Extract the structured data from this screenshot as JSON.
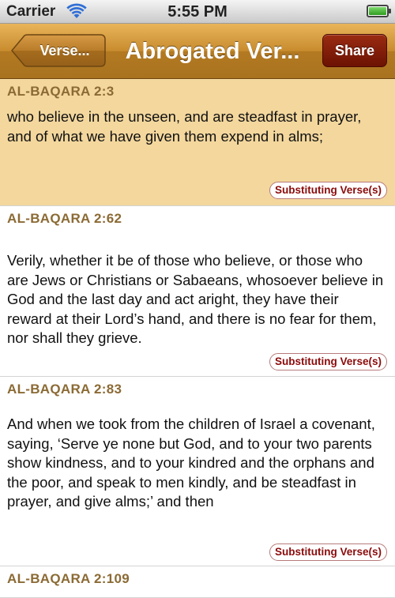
{
  "status_bar": {
    "carrier": "Carrier",
    "time": "5:55 PM",
    "wifi_icon": "wifi-icon",
    "battery_icon": "battery-icon",
    "battery_level": 1.0
  },
  "nav_bar": {
    "back_label": "Verse...",
    "title": "Abrogated Ver...",
    "share_label": "Share"
  },
  "colors": {
    "nav_accent": "#c88c2e",
    "selected_row": "#f3d79d",
    "reference_text": "#8b6a34",
    "share_button": "#7a1906",
    "substitute_text": "#8b0a0a"
  },
  "verses": [
    {
      "reference": "AL-BAQARA  2:3",
      "text": "who believe in the unseen, and are steadfast in prayer, and of what we have given them expend in alms;",
      "button_label": "Substituting Verse(s)",
      "selected": true
    },
    {
      "reference": "AL-BAQARA  2:62",
      "text": "Verily, whether it be of those who believe, or those who are Jews or Christians or Sabaeans, whosoever believe in God and the last day and act aright, they have their reward at their Lord’s hand, and there is no fear for them, nor shall they grieve.",
      "button_label": "Substituting Verse(s)",
      "selected": false
    },
    {
      "reference": "AL-BAQARA  2:83",
      "text": "And when we took from the children of Israel a covenant, saying, ‘Serve ye none but God, and to your two parents show kindness, and to your kindred and the orphans and the poor, and speak to men kindly, and be steadfast in prayer, and give alms;’ and then",
      "button_label": "Substituting Verse(s)",
      "selected": false
    },
    {
      "reference": "AL-BAQARA  2:109",
      "text": "",
      "button_label": "",
      "selected": false
    }
  ]
}
